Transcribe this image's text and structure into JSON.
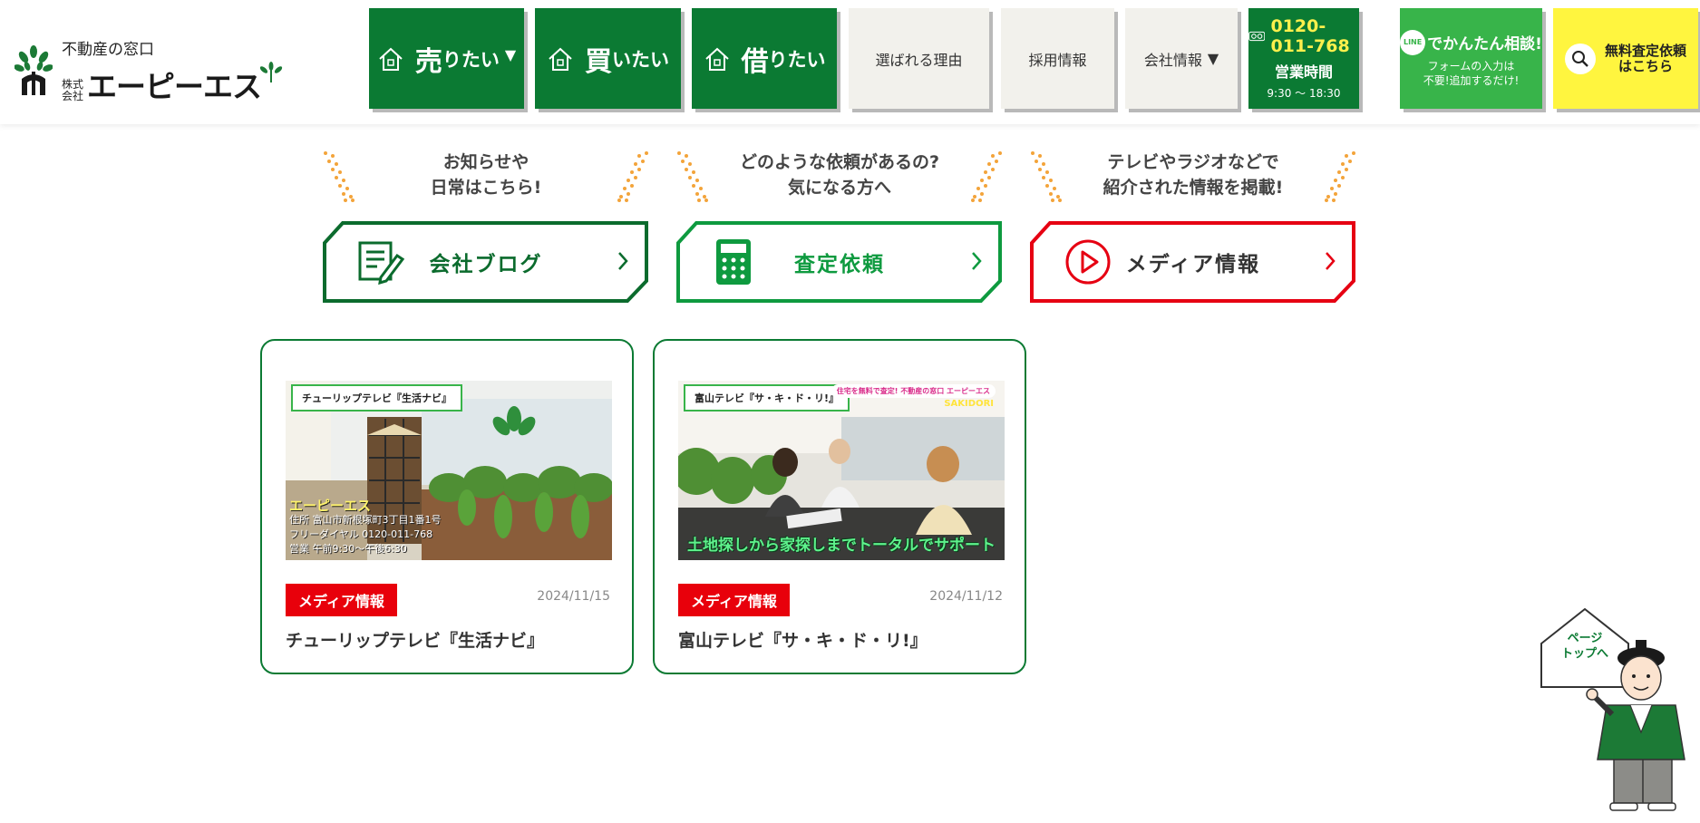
{
  "header": {
    "logo": {
      "line1": "不動産の窓口",
      "kabu": "株式会社",
      "name": "エーピーエス"
    },
    "nav": {
      "sell": {
        "big": "売",
        "small": "りたい"
      },
      "buy": {
        "big": "買",
        "small": "いたい"
      },
      "rent": {
        "big": "借",
        "small": "りたい"
      },
      "reasons": "選ばれる理由",
      "recruit": "採用情報",
      "company": "会社情報",
      "phone": {
        "number": "0120-011-768",
        "label": "営業時間",
        "hours": "9:30 〜 18:30"
      },
      "line": {
        "badge": "LINE",
        "title": "でかんたん相談!",
        "sub1": "フォームの入力は",
        "sub2": "不要!追加するだけ!"
      },
      "search": {
        "line1": "無料査定依頼",
        "line2": "はこちら"
      }
    }
  },
  "categories": [
    {
      "caption1": "お知らせや",
      "caption2": "日常はこちら!",
      "label": "会社ブログ",
      "color": "#0b6b2d",
      "icon": "blog-icon"
    },
    {
      "caption1": "どのような依頼があるの?",
      "caption2": "気になる方へ",
      "label": "査定依頼",
      "color": "#0e9a3f",
      "icon": "calculator-icon"
    },
    {
      "caption1": "テレビやラジオなどで",
      "caption2": "紹介された情報を掲載!",
      "label": "メディア情報",
      "color": "#e60012",
      "icon": "play-icon"
    }
  ],
  "cards": [
    {
      "thumb_title": "チューリップテレビ『生活ナビ』",
      "thumb_name": "エーピーエス",
      "thumb_addr_label": "住所",
      "thumb_addr": "富山市新根塚町3丁目1番1号",
      "thumb_tel_label": "フリーダイヤル",
      "thumb_tel": "0120-011-768",
      "thumb_hours_label": "営業",
      "thumb_hours": "午前9:30〜午後6:30",
      "badge": "メディア情報",
      "date": "2024/11/15",
      "title": "チューリップテレビ『生活ナビ』"
    },
    {
      "thumb_title": "富山テレビ『サ・キ・ド・リ!』",
      "thumb_tag": "住宅を無料で査定! 不動産の窓口 エーピーエス",
      "thumb_tag2": "SAKIDORI",
      "thumb_banner": "土地探しから家探しまでトータルでサポート",
      "badge": "メディア情報",
      "date": "2024/11/12",
      "title": "富山テレビ『サ・キ・ド・リ!』"
    }
  ],
  "pagetop": {
    "line1": "ページ",
    "line2": "トップへ"
  },
  "colors": {
    "brand_green": "#0b7a33",
    "line_green": "#38b44a",
    "search_yellow": "#fff53f",
    "media_red": "#e60012"
  }
}
